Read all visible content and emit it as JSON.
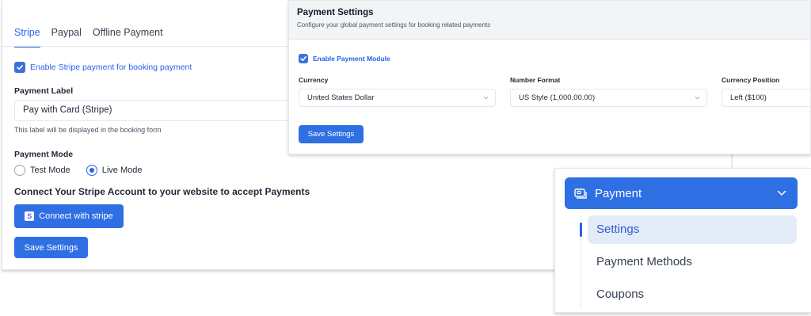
{
  "stripe": {
    "tabs": [
      "Stripe",
      "Paypal",
      "Offline Payment"
    ],
    "enable_label": "Enable Stripe payment for booking payment",
    "payment_label_title": "Payment Label",
    "payment_label_value": "Pay with Card (Stripe)",
    "payment_label_hint": "This label will be displayed in the booking form",
    "payment_mode_title": "Payment Mode",
    "modes": [
      "Test Mode",
      "Live Mode"
    ],
    "selected_mode": "Live Mode",
    "connect_heading": "Connect Your Stripe Account to your website to accept Payments",
    "connect_icon_text": "S",
    "connect_button": "Connect with stripe",
    "save_button": "Save Settings"
  },
  "settings": {
    "title": "Payment Settings",
    "subtitle": "Configure your global payment settings for booking related payments",
    "enable_module_label": "Enable Payment Module",
    "currency_label": "Currency",
    "currency_value": "United States Dollar",
    "number_format_label": "Number Format",
    "number_format_value": "US Style (1,000,00.00)",
    "currency_position_label": "Currency Position",
    "currency_position_value": "Left ($100)",
    "save_button": "Save Settings"
  },
  "menu": {
    "title": "Payment",
    "items": [
      "Settings",
      "Payment Methods",
      "Coupons"
    ],
    "active_item": "Settings"
  },
  "colors": {
    "accent": "#2f6fe4",
    "active_bg": "#e3eaf8"
  }
}
